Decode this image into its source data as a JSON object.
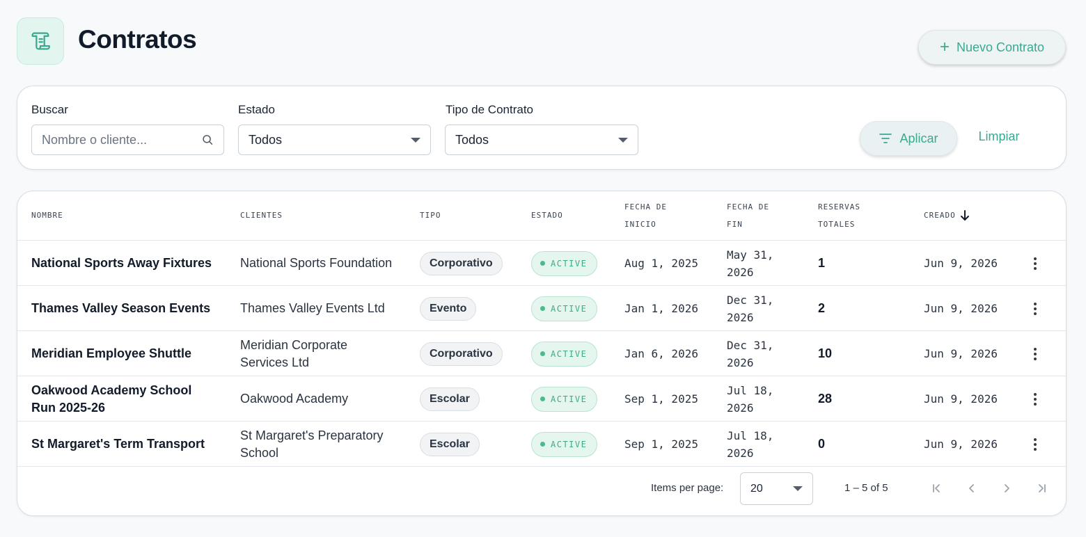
{
  "header": {
    "title": "Contratos",
    "icon": "scroll-icon",
    "new_button_label": "Nuevo Contrato"
  },
  "filters": {
    "search": {
      "label": "Buscar",
      "placeholder": "Nombre o cliente...",
      "value": ""
    },
    "estado": {
      "label": "Estado",
      "value": "Todos"
    },
    "tipo": {
      "label": "Tipo de Contrato",
      "value": "Todos"
    },
    "apply_label": "Aplicar",
    "clear_label": "Limpiar"
  },
  "table": {
    "columns": {
      "nombre": "Nombre",
      "clientes": "Clientes",
      "tipo": "Tipo",
      "estado": "Estado",
      "fecha_inicio_1": "Fecha de",
      "fecha_inicio_2": "Inicio",
      "fecha_fin_1": "Fecha de",
      "fecha_fin_2": "Fin",
      "reservas_1": "Reservas",
      "reservas_2": "Totales",
      "creado": "Creado"
    },
    "sort": {
      "column": "creado",
      "direction": "desc"
    },
    "rows": [
      {
        "name": "National Sports Away Fixtures",
        "client": "National Sports Foundation",
        "type": "Corporativo",
        "status": "ACTIVE",
        "start": "Aug 1, 2025",
        "end": "May 31, 2026",
        "reservations": "1",
        "created": "Jun 9, 2026"
      },
      {
        "name": "Thames Valley Season Events",
        "client": "Thames Valley Events Ltd",
        "type": "Evento",
        "status": "ACTIVE",
        "start": "Jan 1, 2026",
        "end": "Dec 31, 2026",
        "reservations": "2",
        "created": "Jun 9, 2026"
      },
      {
        "name": "Meridian Employee Shuttle",
        "client": "Meridian Corporate Services Ltd",
        "type": "Corporativo",
        "status": "ACTIVE",
        "start": "Jan 6, 2026",
        "end": "Dec 31, 2026",
        "reservations": "10",
        "created": "Jun 9, 2026"
      },
      {
        "name": "Oakwood Academy School Run 2025-26",
        "client": "Oakwood Academy",
        "type": "Escolar",
        "status": "ACTIVE",
        "start": "Sep 1, 2025",
        "end": "Jul 18, 2026",
        "reservations": "28",
        "created": "Jun 9, 2026"
      },
      {
        "name": "St Margaret's Term Transport",
        "client": "St Margaret's Preparatory School",
        "type": "Escolar",
        "status": "ACTIVE",
        "start": "Sep 1, 2025",
        "end": "Jul 18, 2026",
        "reservations": "0",
        "created": "Jun 9, 2026"
      }
    ]
  },
  "paginator": {
    "items_per_page_label": "Items per page:",
    "items_per_page": "20",
    "range": "1 – 5 of 5"
  },
  "colors": {
    "accent": "#3ba890",
    "status_active_bg": "#e5f6ee",
    "status_active_text": "#3eaa83"
  }
}
